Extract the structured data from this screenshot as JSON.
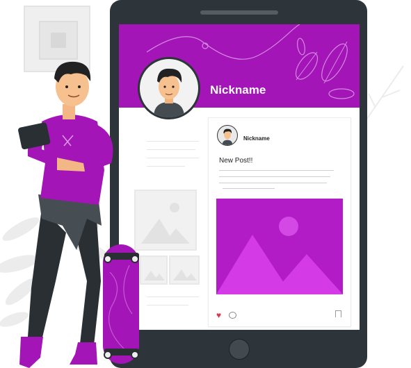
{
  "profile": {
    "nickname": "Nickname"
  },
  "post": {
    "author": "Nickname",
    "text": "New Post!!"
  },
  "colors": {
    "accent": "#a415b8",
    "tablet_body": "#2e353a",
    "heart": "#e0344b"
  },
  "icons": {
    "like": "heart-icon",
    "comment": "comment-icon",
    "save": "bookmark-icon"
  }
}
